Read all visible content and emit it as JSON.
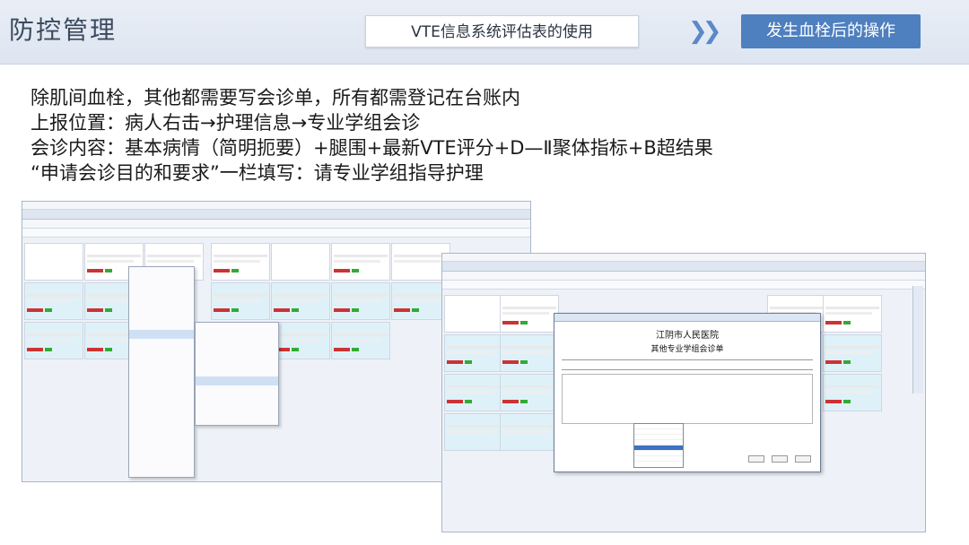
{
  "header": {
    "title": "防控管理",
    "center_title": "VTE信息系统评估表的使用",
    "action_button": "发生血栓后的操作"
  },
  "lines": [
    "除肌间血栓，其他都需要写会诊单，所有都需登记在台账内",
    "上报位置：病人右击→护理信息→专业学组会诊",
    "会诊内容：基本病情（简明扼要）+腿围+最新VTE评分+D—Ⅱ聚体指标+B超结果",
    "“申请会诊目的和要求”一栏填写：请专业学组指导护理"
  ],
  "dialog": {
    "hospital": "江阴市人民医院",
    "form_title": "其他专业学组会诊单"
  }
}
